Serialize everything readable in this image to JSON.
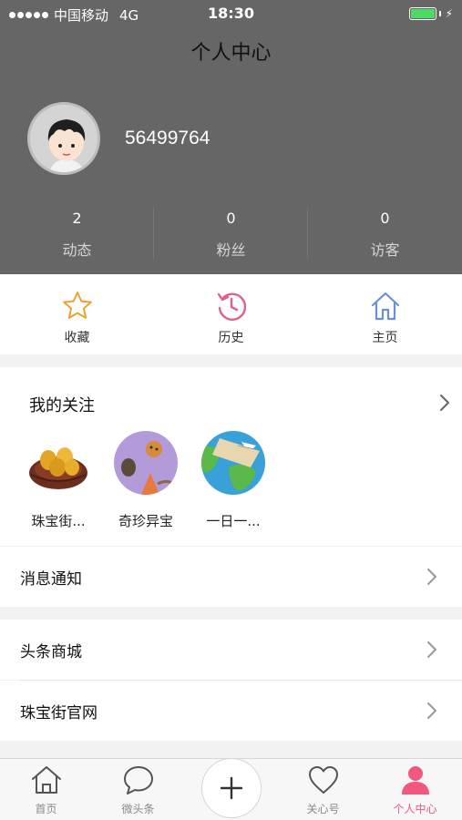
{
  "status_bar": {
    "carrier": "中国移动",
    "network": "4G",
    "time": "18:30",
    "battery_color": "#4cd964"
  },
  "header": {
    "title": "个人中心",
    "username": "56499764",
    "background_color": "#666666",
    "stats": [
      {
        "value": "2",
        "label": "动态"
      },
      {
        "value": "0",
        "label": "粉丝"
      },
      {
        "value": "0",
        "label": "访客"
      }
    ]
  },
  "quick_actions": [
    {
      "label": "收藏",
      "icon": "star-icon",
      "color": "#f0a030"
    },
    {
      "label": "历史",
      "icon": "history-icon",
      "color": "#e0608a"
    },
    {
      "label": "主页",
      "icon": "home-icon",
      "color": "#6b8fd6"
    }
  ],
  "following": {
    "title": "我的关注",
    "items": [
      {
        "name": "珠宝街...",
        "icon": "golden-eggs-nest-image"
      },
      {
        "name": "奇珍异宝",
        "icon": "treasure-still-life-image"
      },
      {
        "name": "一日一...",
        "icon": "travel-globe-image"
      }
    ]
  },
  "menu": [
    {
      "label": "消息通知"
    },
    {
      "label": "头条商城"
    },
    {
      "label": "珠宝街官网"
    }
  ],
  "tabbar": {
    "accent_color": "#f0587e",
    "tabs": [
      {
        "label": "首页",
        "icon": "home-icon"
      },
      {
        "label": "微头条",
        "icon": "chat-bubble-icon"
      },
      {
        "label": "",
        "icon": "plus-icon"
      },
      {
        "label": "关心号",
        "icon": "heart-icon"
      },
      {
        "label": "个人中心",
        "icon": "person-icon",
        "active": true
      }
    ]
  }
}
